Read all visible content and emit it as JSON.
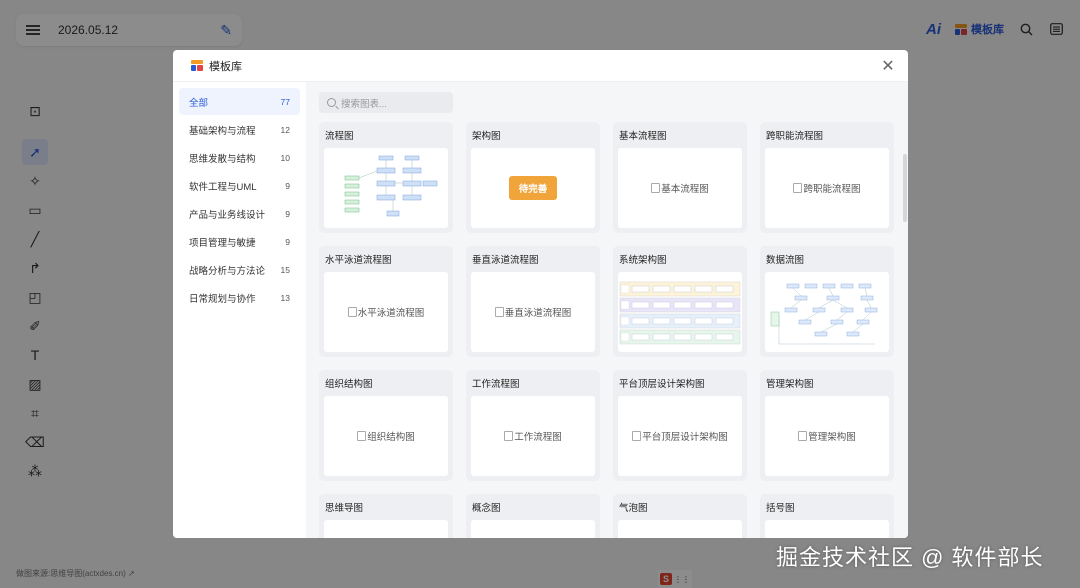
{
  "app": {
    "doc_title": "2026.05.12",
    "ai_label": "Ai",
    "template_button_label": "模板库",
    "footer_text": "做图来源:思维导图(actxdes.cn) ↗",
    "badge_letter": "S"
  },
  "watermark": "掘金技术社区 @ 软件部长",
  "modal": {
    "title": "模板库",
    "search_placeholder": "搜索图表...",
    "categories": [
      {
        "label": "全部",
        "count": "77",
        "active": true
      },
      {
        "label": "基础架构与流程",
        "count": "12"
      },
      {
        "label": "思维发散与结构",
        "count": "10"
      },
      {
        "label": "软件工程与UML",
        "count": "9"
      },
      {
        "label": "产品与业务线设计",
        "count": "9"
      },
      {
        "label": "项目管理与敏捷",
        "count": "9"
      },
      {
        "label": "战略分析与方法论",
        "count": "15"
      },
      {
        "label": "日常规划与协作",
        "count": "13"
      }
    ],
    "templates": [
      {
        "title": "流程图",
        "thumb": "diagram-flow"
      },
      {
        "title": "架构图",
        "thumb": "pending",
        "pending_label": "待完善"
      },
      {
        "title": "基本流程图",
        "thumb": "broken",
        "alt": "基本流程图"
      },
      {
        "title": "跨职能流程图",
        "thumb": "broken",
        "alt": "跨职能流程图"
      },
      {
        "title": "水平泳道流程图",
        "thumb": "broken",
        "alt": "水平泳道流程图"
      },
      {
        "title": "垂直泳道流程图",
        "thumb": "broken",
        "alt": "垂直泳道流程图"
      },
      {
        "title": "系统架构图",
        "thumb": "diagram-arch"
      },
      {
        "title": "数据流图",
        "thumb": "diagram-dataflow"
      },
      {
        "title": "组织结构图",
        "thumb": "broken",
        "alt": "组织结构图"
      },
      {
        "title": "工作流程图",
        "thumb": "broken",
        "alt": "工作流程图"
      },
      {
        "title": "平台顶层设计架构图",
        "thumb": "broken",
        "alt": "平台顶层设计架构图"
      },
      {
        "title": "管理架构图",
        "thumb": "broken",
        "alt": "管理架构图"
      },
      {
        "title": "思维导图",
        "thumb": "blank"
      },
      {
        "title": "概念图",
        "thumb": "blank"
      },
      {
        "title": "气泡图",
        "thumb": "blank"
      },
      {
        "title": "括号图",
        "thumb": "blank"
      }
    ]
  },
  "colors": {
    "accent": "#2a5bd7",
    "pending": "#f0a43a",
    "logo_orange": "#f59b23",
    "logo_red": "#e04646"
  },
  "icons": {
    "menu": "hamburger-icon",
    "edit": "pencil-icon",
    "search": "search-icon",
    "list": "list-icon",
    "close": "close-icon"
  }
}
